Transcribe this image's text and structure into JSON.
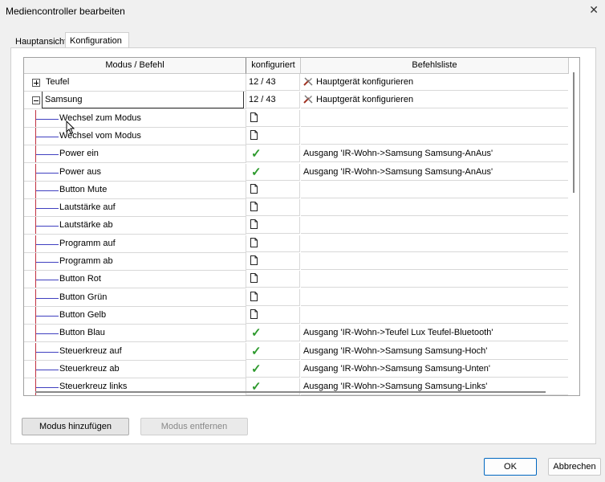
{
  "window": {
    "title": "Mediencontroller bearbeiten",
    "close_glyph": "✕"
  },
  "tabs": [
    {
      "label": "Hauptansicht"
    },
    {
      "label": "Konfiguration"
    }
  ],
  "grid": {
    "columns": [
      "Modus / Befehl",
      "konfiguriert",
      "Befehlsliste"
    ],
    "parents": [
      {
        "label": "Teufel",
        "count": "12 / 43",
        "action": "Hauptgerät konfigurieren",
        "expanded": false
      },
      {
        "label": "Samsung",
        "count": "12 / 43",
        "action": "Hauptgerät konfigurieren",
        "expanded": true
      }
    ],
    "children": [
      {
        "label": "Wechsel zum Modus",
        "status": "doc",
        "command": ""
      },
      {
        "label": "Wechsel vom Modus",
        "status": "doc",
        "command": ""
      },
      {
        "label": "Power ein",
        "status": "check",
        "command": "Ausgang 'IR-Wohn->Samsung Samsung-AnAus'"
      },
      {
        "label": "Power aus",
        "status": "check",
        "command": "Ausgang 'IR-Wohn->Samsung Samsung-AnAus'"
      },
      {
        "label": "Button Mute",
        "status": "doc",
        "command": ""
      },
      {
        "label": "Lautstärke auf",
        "status": "doc",
        "command": ""
      },
      {
        "label": "Lautstärke ab",
        "status": "doc",
        "command": ""
      },
      {
        "label": "Programm auf",
        "status": "doc",
        "command": ""
      },
      {
        "label": "Programm ab",
        "status": "doc",
        "command": ""
      },
      {
        "label": "Button Rot",
        "status": "doc",
        "command": ""
      },
      {
        "label": "Button Grün",
        "status": "doc",
        "command": ""
      },
      {
        "label": "Button Gelb",
        "status": "doc",
        "command": ""
      },
      {
        "label": "Button Blau",
        "status": "check",
        "command": "Ausgang 'IR-Wohn->Teufel Lux Teufel-Bluetooth'"
      },
      {
        "label": "Steuerkreuz auf",
        "status": "check",
        "command": "Ausgang 'IR-Wohn->Samsung Samsung-Hoch'"
      },
      {
        "label": "Steuerkreuz ab",
        "status": "check",
        "command": "Ausgang 'IR-Wohn->Samsung Samsung-Unten'"
      },
      {
        "label": "Steuerkreuz links",
        "status": "check",
        "command": "Ausgang 'IR-Wohn->Samsung Samsung-Links'"
      }
    ]
  },
  "buttons": {
    "add_mode": "Modus hinzufügen",
    "remove_mode": "Modus entfernen",
    "ok": "OK",
    "cancel": "Abbrechen"
  },
  "colors": {
    "check": "#2e9a2e",
    "tree_vertical": "#c03040",
    "tree_horizontal": "#4040c0",
    "ok_border": "#0067c0"
  },
  "check_glyph": "✓"
}
